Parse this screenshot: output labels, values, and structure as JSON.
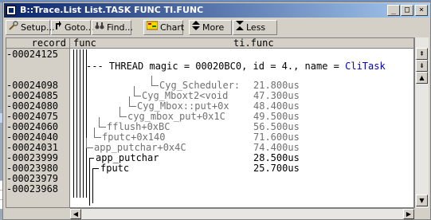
{
  "window": {
    "title": "B::Trace.List List.TASK FUNC TI.FUNC"
  },
  "caption_buttons": {
    "minimize": "_",
    "maximize": "□",
    "close": "×"
  },
  "toolbar": {
    "setup": "Setup...",
    "goto": "Goto...",
    "find": "Find...",
    "chart": "Chart",
    "more": "More",
    "less": "Less"
  },
  "columns": {
    "record": "record",
    "func": "func",
    "tifunc": "ti.func"
  },
  "thread_line": "THREAD magic = 00020BC0, id = 4., name = CliTask",
  "records": [
    "-00024125",
    "-00024098",
    "-00024085",
    "-00024080",
    "-00024075",
    "-00024060",
    "-00024040",
    "-00024031",
    "-00023999",
    "-00023980",
    "-00023979",
    "-00023968"
  ],
  "func_entries": [
    {
      "name": "Cyg_Scheduler:",
      "time": "21.800us",
      "color": "#707070"
    },
    {
      "name": "Cyg_Mboxt2<void",
      "time": "47.300us",
      "color": "#707070"
    },
    {
      "name": "Cyg_Mbox::put+0x",
      "time": "48.400us",
      "color": "#707070"
    },
    {
      "name": "cyg_mbox_put+0x1C",
      "time": "49.500us",
      "color": "#707070"
    },
    {
      "name": "fflush+0xBC",
      "time": "56.500us",
      "color": "#707070"
    },
    {
      "name": "fputc+0x140",
      "time": "71.600us",
      "color": "#707070"
    },
    {
      "name": "app_putchar+0x4C",
      "time": "74.400us",
      "color": "#707070"
    },
    {
      "name": "app_putchar",
      "time": "28.500us",
      "color": "#000000"
    },
    {
      "name": "fputc",
      "time": "25.700us",
      "color": "#000000"
    }
  ],
  "background_cells": [
    "1.",
    "1.",
    "1."
  ],
  "colors": {
    "titlebar_start": "#0a246a",
    "titlebar_end": "#a6caf0",
    "task_name": "#0000c0"
  },
  "icons": {
    "setup": "wrench-icon",
    "goto": "goto-icon",
    "find": "binoculars-icon",
    "chart": "chart-icon",
    "more": "more-arrows-icon",
    "less": "less-arrows-icon"
  }
}
